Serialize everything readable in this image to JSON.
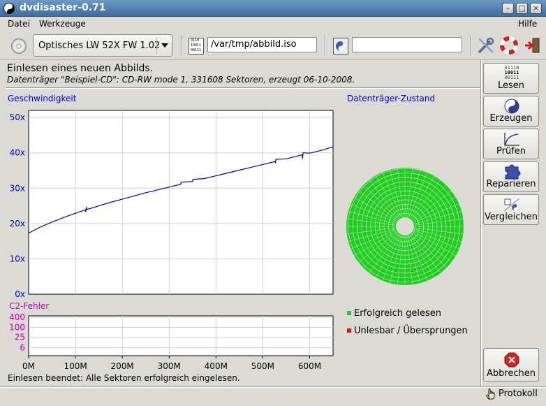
{
  "window": {
    "title": "dvdisaster-0.71",
    "minimize": "–",
    "maximize": "□",
    "close": "×"
  },
  "menu": {
    "file": "Datei",
    "tools": "Werkzeuge",
    "help": "Hilfe"
  },
  "toolbar": {
    "drive": "Optisches LW 52X FW 1.02",
    "image_file": "/var/tmp/abbild.iso",
    "ecc_file": "",
    "binary_icon_text": [
      "0110",
      "10011",
      "00111"
    ]
  },
  "status": {
    "headline": "Einlesen eines neuen Abbilds.",
    "subline": "Datenträger \"Beispiel-CD\": CD-RW mode 1, 331608 Sektoren, erzeugt 06-10-2008.",
    "bottom": "Einlesen beendet: Alle Sektoren erfolgreich eingelesen."
  },
  "panels": {
    "speed_title": "Geschwindigkeit",
    "state_title": "Datenträger-Zustand",
    "c2_title": "C2-Fehler"
  },
  "legend": {
    "ok": "Erfolgreich gelesen",
    "bad": "Unlesbar / Übersprungen"
  },
  "sidebar": {
    "read": "Lesen",
    "read_icon_text": [
      "01110",
      "10011",
      "00111"
    ],
    "create": "Erzeugen",
    "verify": "Prüfen",
    "repair": "Reparieren",
    "compare": "Vergleichen",
    "abort": "Abbrechen"
  },
  "log_button": "Protokoll",
  "colors": {
    "speed_axis": "#0000c0",
    "c2_axis": "#c000c0",
    "read_ok": "#22cc22",
    "unreadable": "#dd1111"
  },
  "chart_data": [
    {
      "type": "line",
      "title": "Geschwindigkeit",
      "x_unit": "M",
      "x_ticks": [
        "0M",
        "100M",
        "200M",
        "300M",
        "400M",
        "500M",
        "600M"
      ],
      "x_tick_values": [
        0,
        100,
        200,
        300,
        400,
        500,
        600
      ],
      "xlim": [
        0,
        650
      ],
      "y_ticks": [
        "0x",
        "10x",
        "20x",
        "30x",
        "40x",
        "50x"
      ],
      "y_tick_values": [
        0,
        10,
        20,
        30,
        40,
        50
      ],
      "ylim": [
        0,
        52
      ],
      "grid": true,
      "x": [
        0,
        25,
        50,
        75,
        100,
        125,
        150,
        175,
        200,
        225,
        250,
        275,
        300,
        325,
        350,
        375,
        400,
        425,
        450,
        475,
        500,
        525,
        550,
        575,
        600,
        625,
        650
      ],
      "y": [
        17.3,
        19.0,
        20.4,
        21.7,
        22.9,
        24.0,
        25.0,
        26.0,
        26.9,
        27.8,
        28.7,
        29.5,
        30.3,
        31.1,
        31.9,
        32.7,
        33.5,
        34.3,
        35.1,
        35.9,
        36.7,
        37.5,
        38.3,
        39.1,
        39.9,
        40.7,
        41.7
      ],
      "dips": [
        {
          "x": 122,
          "y": 23.4
        },
        {
          "x": 325,
          "y": 31.3
        },
        {
          "x": 350,
          "y": 32.0
        },
        {
          "x": 527,
          "y": 37.2
        },
        {
          "x": 585,
          "y": 38.5
        }
      ]
    },
    {
      "type": "line",
      "title": "C2-Fehler",
      "y_ticks": [
        "400",
        "100",
        "25",
        "6"
      ],
      "y_tick_values": [
        400,
        100,
        25,
        6
      ],
      "xlim": [
        0,
        650
      ],
      "grid": true,
      "x": [
        0,
        650
      ],
      "y": [
        0,
        0
      ]
    }
  ]
}
